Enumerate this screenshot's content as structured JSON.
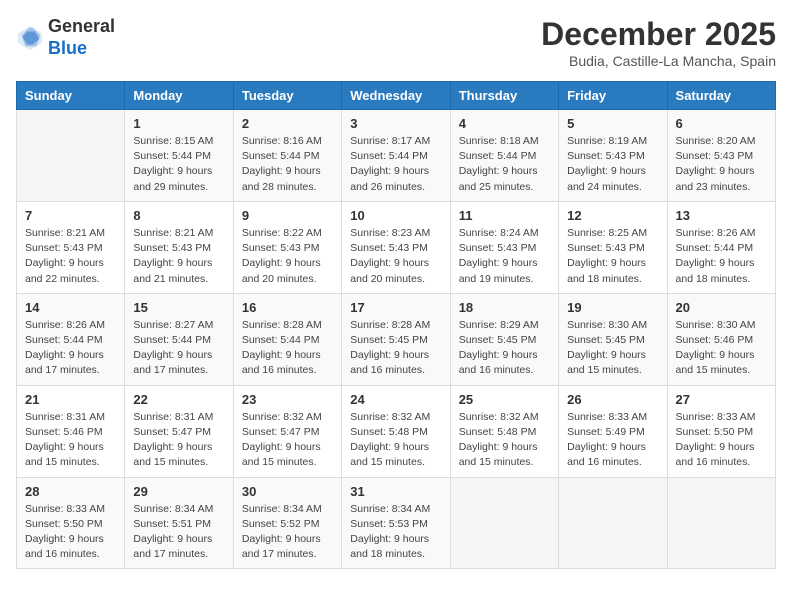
{
  "logo": {
    "general": "General",
    "blue": "Blue"
  },
  "header": {
    "title": "December 2025",
    "subtitle": "Budia, Castille-La Mancha, Spain"
  },
  "columns": [
    "Sunday",
    "Monday",
    "Tuesday",
    "Wednesday",
    "Thursday",
    "Friday",
    "Saturday"
  ],
  "weeks": [
    [
      {
        "day": "",
        "info": ""
      },
      {
        "day": "1",
        "info": "Sunrise: 8:15 AM\nSunset: 5:44 PM\nDaylight: 9 hours\nand 29 minutes."
      },
      {
        "day": "2",
        "info": "Sunrise: 8:16 AM\nSunset: 5:44 PM\nDaylight: 9 hours\nand 28 minutes."
      },
      {
        "day": "3",
        "info": "Sunrise: 8:17 AM\nSunset: 5:44 PM\nDaylight: 9 hours\nand 26 minutes."
      },
      {
        "day": "4",
        "info": "Sunrise: 8:18 AM\nSunset: 5:44 PM\nDaylight: 9 hours\nand 25 minutes."
      },
      {
        "day": "5",
        "info": "Sunrise: 8:19 AM\nSunset: 5:43 PM\nDaylight: 9 hours\nand 24 minutes."
      },
      {
        "day": "6",
        "info": "Sunrise: 8:20 AM\nSunset: 5:43 PM\nDaylight: 9 hours\nand 23 minutes."
      }
    ],
    [
      {
        "day": "7",
        "info": "Sunrise: 8:21 AM\nSunset: 5:43 PM\nDaylight: 9 hours\nand 22 minutes."
      },
      {
        "day": "8",
        "info": "Sunrise: 8:21 AM\nSunset: 5:43 PM\nDaylight: 9 hours\nand 21 minutes."
      },
      {
        "day": "9",
        "info": "Sunrise: 8:22 AM\nSunset: 5:43 PM\nDaylight: 9 hours\nand 20 minutes."
      },
      {
        "day": "10",
        "info": "Sunrise: 8:23 AM\nSunset: 5:43 PM\nDaylight: 9 hours\nand 20 minutes."
      },
      {
        "day": "11",
        "info": "Sunrise: 8:24 AM\nSunset: 5:43 PM\nDaylight: 9 hours\nand 19 minutes."
      },
      {
        "day": "12",
        "info": "Sunrise: 8:25 AM\nSunset: 5:43 PM\nDaylight: 9 hours\nand 18 minutes."
      },
      {
        "day": "13",
        "info": "Sunrise: 8:26 AM\nSunset: 5:44 PM\nDaylight: 9 hours\nand 18 minutes."
      }
    ],
    [
      {
        "day": "14",
        "info": "Sunrise: 8:26 AM\nSunset: 5:44 PM\nDaylight: 9 hours\nand 17 minutes."
      },
      {
        "day": "15",
        "info": "Sunrise: 8:27 AM\nSunset: 5:44 PM\nDaylight: 9 hours\nand 17 minutes."
      },
      {
        "day": "16",
        "info": "Sunrise: 8:28 AM\nSunset: 5:44 PM\nDaylight: 9 hours\nand 16 minutes."
      },
      {
        "day": "17",
        "info": "Sunrise: 8:28 AM\nSunset: 5:45 PM\nDaylight: 9 hours\nand 16 minutes."
      },
      {
        "day": "18",
        "info": "Sunrise: 8:29 AM\nSunset: 5:45 PM\nDaylight: 9 hours\nand 16 minutes."
      },
      {
        "day": "19",
        "info": "Sunrise: 8:30 AM\nSunset: 5:45 PM\nDaylight: 9 hours\nand 15 minutes."
      },
      {
        "day": "20",
        "info": "Sunrise: 8:30 AM\nSunset: 5:46 PM\nDaylight: 9 hours\nand 15 minutes."
      }
    ],
    [
      {
        "day": "21",
        "info": "Sunrise: 8:31 AM\nSunset: 5:46 PM\nDaylight: 9 hours\nand 15 minutes."
      },
      {
        "day": "22",
        "info": "Sunrise: 8:31 AM\nSunset: 5:47 PM\nDaylight: 9 hours\nand 15 minutes."
      },
      {
        "day": "23",
        "info": "Sunrise: 8:32 AM\nSunset: 5:47 PM\nDaylight: 9 hours\nand 15 minutes."
      },
      {
        "day": "24",
        "info": "Sunrise: 8:32 AM\nSunset: 5:48 PM\nDaylight: 9 hours\nand 15 minutes."
      },
      {
        "day": "25",
        "info": "Sunrise: 8:32 AM\nSunset: 5:48 PM\nDaylight: 9 hours\nand 15 minutes."
      },
      {
        "day": "26",
        "info": "Sunrise: 8:33 AM\nSunset: 5:49 PM\nDaylight: 9 hours\nand 16 minutes."
      },
      {
        "day": "27",
        "info": "Sunrise: 8:33 AM\nSunset: 5:50 PM\nDaylight: 9 hours\nand 16 minutes."
      }
    ],
    [
      {
        "day": "28",
        "info": "Sunrise: 8:33 AM\nSunset: 5:50 PM\nDaylight: 9 hours\nand 16 minutes."
      },
      {
        "day": "29",
        "info": "Sunrise: 8:34 AM\nSunset: 5:51 PM\nDaylight: 9 hours\nand 17 minutes."
      },
      {
        "day": "30",
        "info": "Sunrise: 8:34 AM\nSunset: 5:52 PM\nDaylight: 9 hours\nand 17 minutes."
      },
      {
        "day": "31",
        "info": "Sunrise: 8:34 AM\nSunset: 5:53 PM\nDaylight: 9 hours\nand 18 minutes."
      },
      {
        "day": "",
        "info": ""
      },
      {
        "day": "",
        "info": ""
      },
      {
        "day": "",
        "info": ""
      }
    ]
  ]
}
